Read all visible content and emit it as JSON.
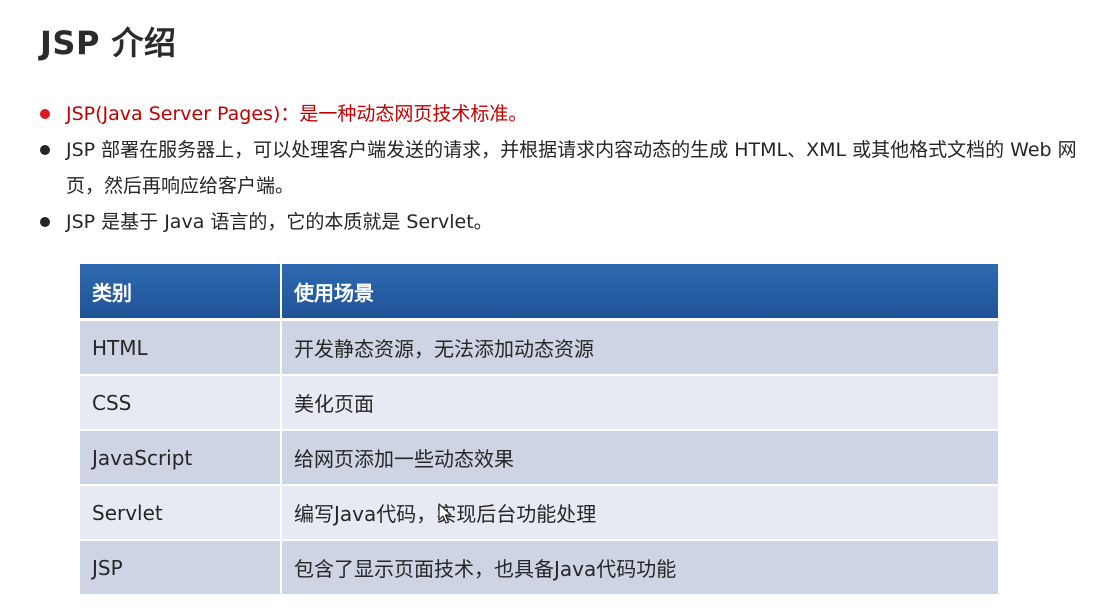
{
  "title": "JSP 介绍",
  "bullets": [
    {
      "text": "JSP(Java Server Pages)：是一种动态网页技术标准。",
      "color": "#c00000"
    },
    {
      "text": "JSP 部署在服务器上，可以处理客户端发送的请求，并根据请求内容动态的生成 HTML、XML 或其他格式文档的 Web 网页，然后再响应给客户端。",
      "color": "#262626"
    },
    {
      "text": "JSP 是基于 Java 语言的，它的本质就是 Servlet。",
      "color": "#262626"
    }
  ],
  "table": {
    "headers": [
      "类别",
      "使用场景"
    ],
    "rows": [
      [
        "HTML",
        "开发静态资源，无法添加动态资源"
      ],
      [
        "CSS",
        "美化页面"
      ],
      [
        "JavaScript",
        "给网页添加一些动态效果"
      ],
      [
        "Servlet",
        "编写Java代码，实现后台功能处理"
      ],
      [
        "JSP",
        "包含了显示页面技术，也具备Java代码功能"
      ]
    ],
    "header_color": "#2a62a8",
    "row_colors": [
      "#cdd4e3",
      "#e7eaf2"
    ]
  },
  "cursor_icon": "mouse-pointer-icon"
}
